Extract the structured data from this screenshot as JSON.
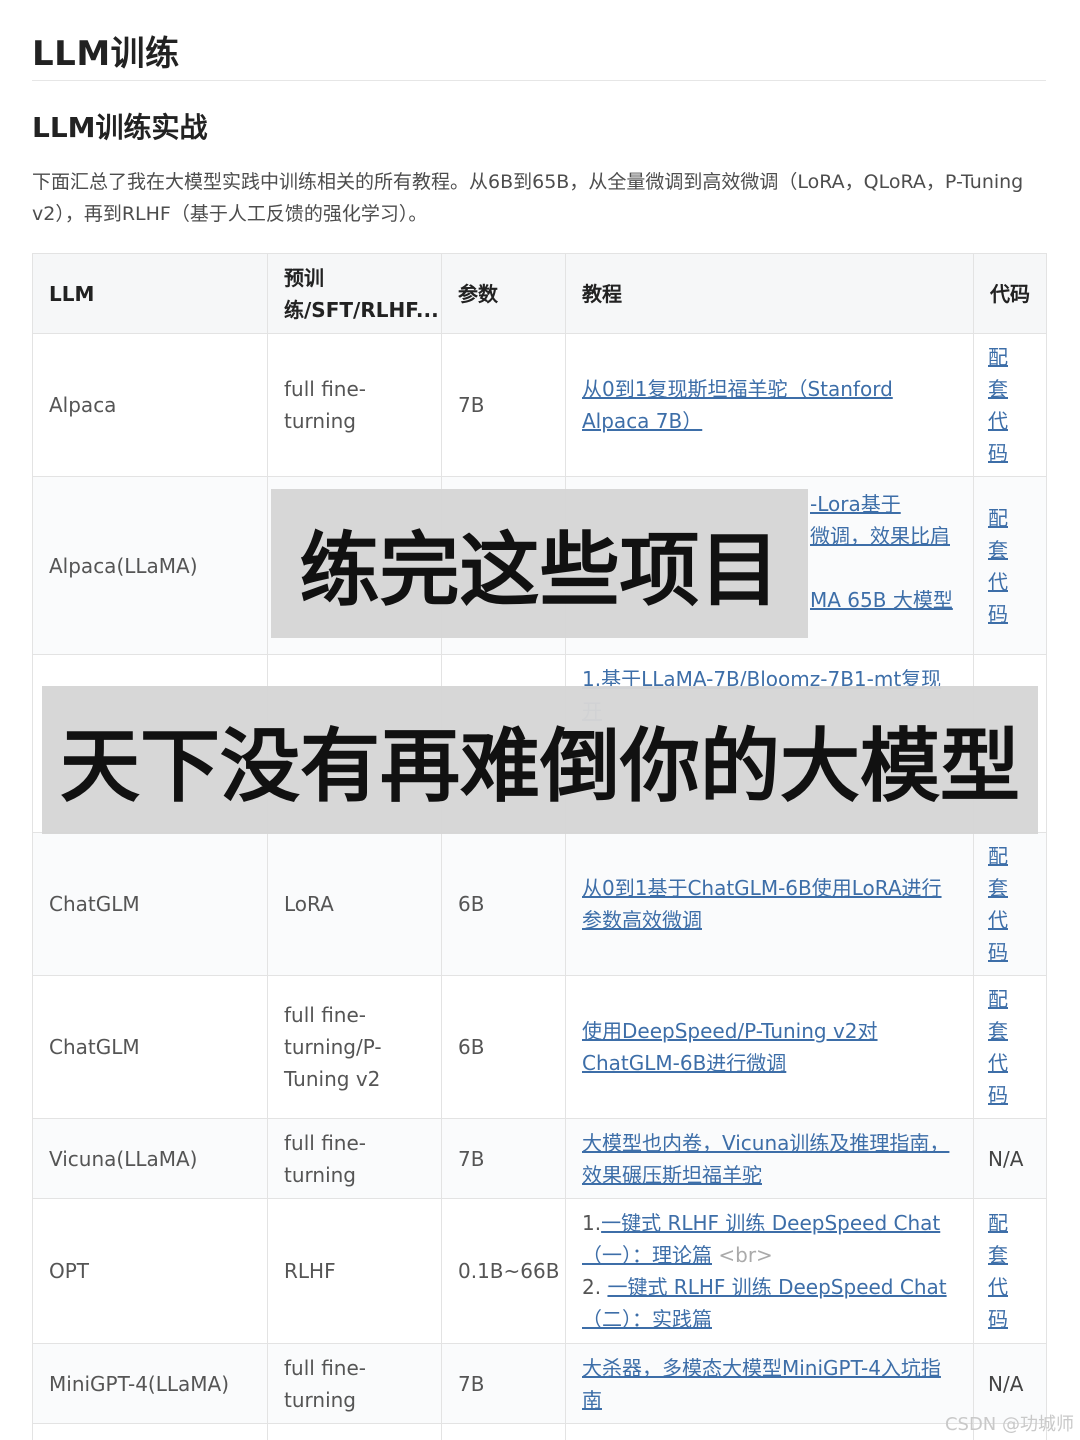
{
  "page": {
    "heading": "LLM训练",
    "subheading": "LLM训练实战",
    "intro": "下面汇总了我在大模型实践中训练相关的所有教程。从6B到65B，从全量微调到高效微调（LoRA，QLoRA，P-Tuning v2），再到RLHF（基于人工反馈的强化学习）。"
  },
  "table": {
    "headers": [
      "LLM",
      "预训练/SFT/RLHF...",
      "参数",
      "教程",
      "代码"
    ],
    "rows": [
      {
        "llm": "Alpaca",
        "method": "full fine-turning",
        "params": "7B",
        "tutorial": "从0到1复现斯坦福羊驼（Stanford Alpaca 7B）",
        "code": "配套代码"
      },
      {
        "llm": "Alpaca(LLaMA)",
        "method": "",
        "params": "",
        "tutorial": "",
        "code": "配套代码"
      },
      {
        "llm": "",
        "method": "",
        "params": "",
        "tutorial": "1.基于LLaMA-7B/Bloomz-7B1-mt复现开",
        "code": ""
      },
      {
        "llm": "ChatGLM",
        "method": "LoRA",
        "params": "6B",
        "tutorial": "从0到1基于ChatGLM-6B使用LoRA进行参数高效微调",
        "code": "配套代码"
      },
      {
        "llm": "ChatGLM",
        "method": "full fine-turning/P-Tuning v2",
        "params": "6B",
        "tutorial": "使用DeepSpeed/P-Tuning v2对ChatGLM-6B进行微调",
        "code": "配套代码"
      },
      {
        "llm": "Vicuna(LLaMA)",
        "method": "full fine-turning",
        "params": "7B",
        "tutorial": "大模型也内卷，Vicuna训练及推理指南，效果碾压斯坦福羊驼",
        "code": "N/A"
      },
      {
        "llm": "OPT",
        "method": "RLHF",
        "params": "0.1B~66B",
        "tutorial": "",
        "code": "配套代码"
      },
      {
        "llm": "MiniGPT-4(LLaMA)",
        "method": "full fine-turning",
        "params": "7B",
        "tutorial": "大杀器，多模态大模型MiniGPT-4入坑指南",
        "code": "N/A"
      }
    ],
    "alpaca_llama_fragments": [
      "-Lora基于",
      "微调，效果比肩",
      "MA 65B 大模型"
    ],
    "opt_tutorial": {
      "item1_prefix": "1.",
      "item1_link": "一键式 RLHF 训练 DeepSpeed Chat（一）：理论篇",
      "br_tag": "<br>",
      "item2_prefix": "2.",
      "item2_link": "一键式 RLHF 训练 DeepSpeed Chat（二）：实践篇"
    }
  },
  "overlays": {
    "line1": "练完这些项目",
    "line2": "天下没有再难倒你的大模型"
  },
  "watermark": "CSDN @功城师",
  "colors": {
    "link": "#3d6ea8",
    "header_bg": "#f6f7f8",
    "overlay_bg": "#d6d6d6"
  }
}
